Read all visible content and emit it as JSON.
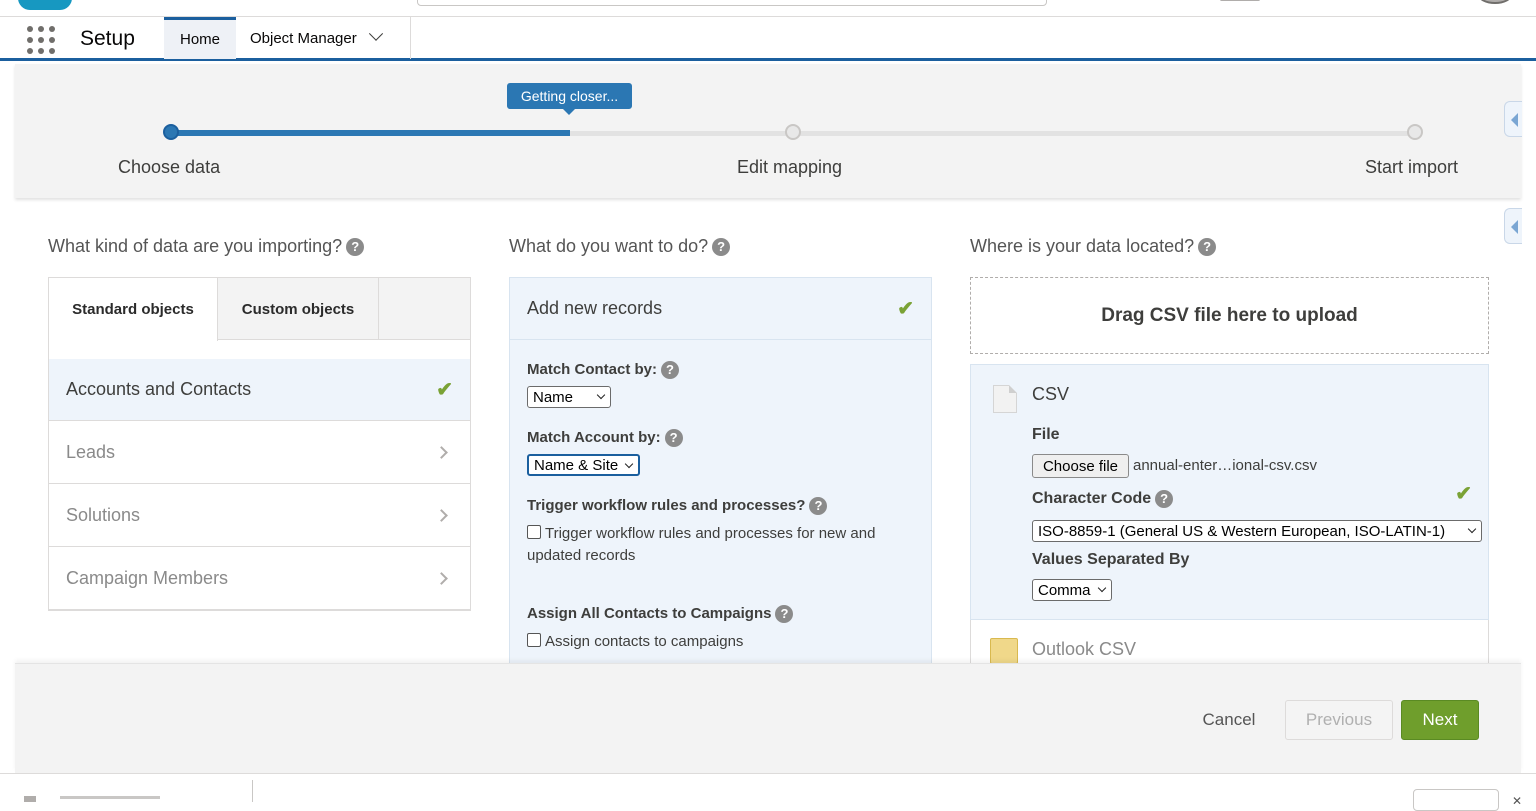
{
  "header": {
    "app_name": "Setup",
    "tabs": [
      {
        "label": "Home"
      },
      {
        "label": "Object Manager"
      }
    ]
  },
  "wizard": {
    "tooltip": "Getting closer...",
    "progress": 0.32,
    "steps": [
      {
        "label": "Choose data"
      },
      {
        "label": "Edit mapping"
      },
      {
        "label": "Start import"
      }
    ]
  },
  "left": {
    "heading": "What kind of data are you importing?",
    "tabs": [
      "Standard objects",
      "Custom objects"
    ],
    "items": [
      {
        "label": "Accounts and Contacts",
        "selected": true
      },
      {
        "label": "Leads"
      },
      {
        "label": "Solutions"
      },
      {
        "label": "Campaign Members"
      }
    ]
  },
  "middle": {
    "heading": "What do you want to do?",
    "action": "Add new records",
    "match_contact_label": "Match Contact by:",
    "match_contact_value": "Name",
    "match_account_label": "Match Account by:",
    "match_account_value": "Name & Site",
    "trigger_label": "Trigger workflow rules and processes?",
    "trigger_checkbox": "Trigger workflow rules and processes for new and updated records",
    "assign_label": "Assign All Contacts to Campaigns",
    "assign_checkbox": "Assign contacts to campaigns"
  },
  "right": {
    "heading": "Where is your data located?",
    "drop_zone": "Drag CSV file here to upload",
    "csv_title": "CSV",
    "file_label": "File",
    "choose_file": "Choose file",
    "file_name": "annual-enter…ional-csv.csv",
    "char_code_label": "Character Code",
    "char_code_value": "ISO-8859-1 (General US & Western European, ISO-LATIN-1)",
    "separator_label": "Values Separated By",
    "separator_value": "Comma",
    "outlook_label": "Outlook CSV"
  },
  "footer": {
    "cancel": "Cancel",
    "previous": "Previous",
    "next": "Next"
  },
  "colors": {
    "brand_blue": "#2b77b3",
    "success_green": "#6f9e2c"
  }
}
